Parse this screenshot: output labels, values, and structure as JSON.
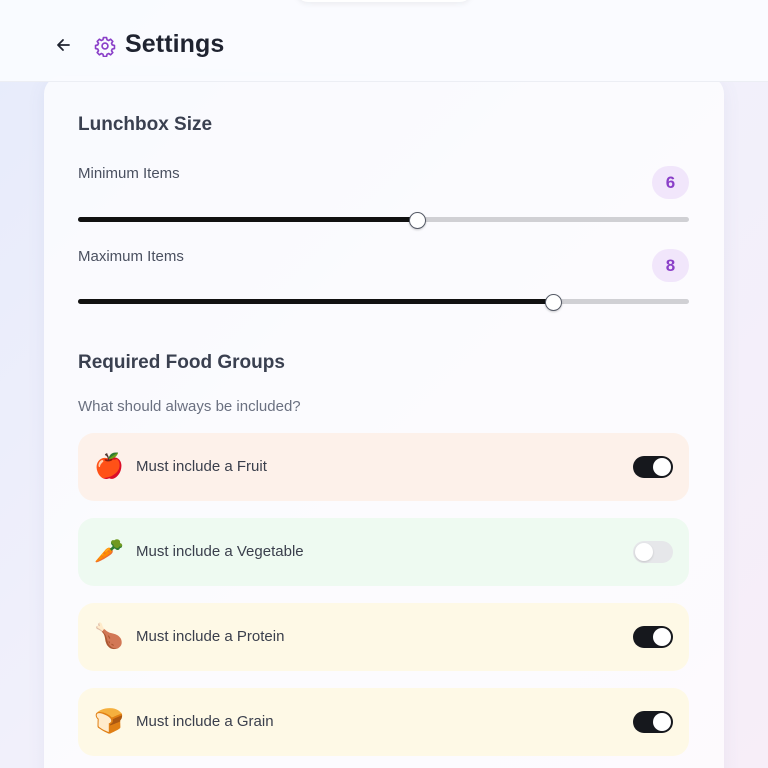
{
  "header": {
    "title": "Settings",
    "back_icon": "arrow-left-icon",
    "title_icon": "gear-icon",
    "accent_color": "#8a3fc8"
  },
  "lunchbox_size": {
    "title": "Lunchbox Size",
    "slider_min": 1,
    "slider_max": 10,
    "minimum": {
      "label": "Minimum Items",
      "value": "6"
    },
    "maximum": {
      "label": "Maximum Items",
      "value": "8"
    }
  },
  "food_groups": {
    "title": "Required Food Groups",
    "subtitle": "What should always be included?",
    "items": [
      {
        "emoji": "🍎",
        "icon": "apple-icon",
        "label": "Must include a Fruit",
        "enabled": true,
        "bg": "#fdf1ea"
      },
      {
        "emoji": "🥕",
        "icon": "carrot-icon",
        "label": "Must include a Vegetable",
        "enabled": false,
        "bg": "#eefaf1"
      },
      {
        "emoji": "🍗",
        "icon": "drumstick-icon",
        "label": "Must include a Protein",
        "enabled": true,
        "bg": "#fef9e6"
      },
      {
        "emoji": "🍞",
        "icon": "bread-icon",
        "label": "Must include a Grain",
        "enabled": true,
        "bg": "#fef9e6"
      }
    ]
  }
}
